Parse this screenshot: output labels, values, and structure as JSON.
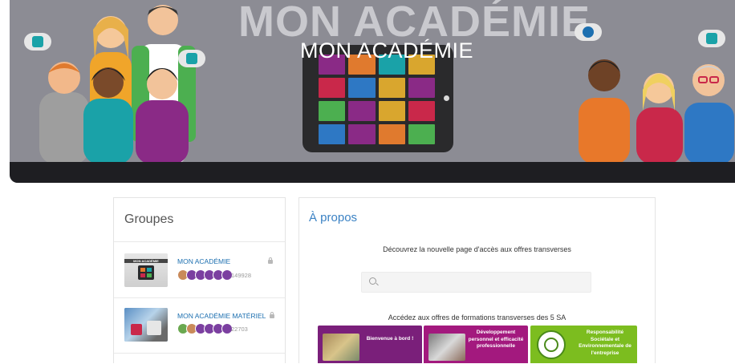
{
  "banner": {
    "background_title": "MON ACADÉMIE",
    "title": "MON ACADÉMIE"
  },
  "groups": {
    "heading": "Groupes",
    "items": [
      {
        "name": "MON ACADÉMIE",
        "thumb_label": "MON ACADÉMIE",
        "members": "149928"
      },
      {
        "name": "MON ACADÉMIE MATÉRIEL",
        "members": "22703"
      }
    ]
  },
  "about": {
    "heading": "À propos",
    "intro": "Découvrez la nouvelle page d'accès aux offres transverses",
    "search": {
      "value": "",
      "placeholder": ""
    },
    "offers_heading": "Accédez aux offres de formations transverses des 5 SA",
    "offers": [
      {
        "label": "Bienvenue à bord !",
        "color": "#7a1f7a"
      },
      {
        "label": "Développement personnel et efficacité professionnelle",
        "color": "#a3197e"
      },
      {
        "label": "Responsabilité Sociétale et Environnementale de l'entreprise",
        "color": "#7cbd1f"
      }
    ]
  },
  "colors": {
    "accent_blue": "#3b82c4",
    "link_blue": "#1c6fb0",
    "banner_grey": "#8c8c94",
    "banner_dark": "#1e1e22"
  }
}
